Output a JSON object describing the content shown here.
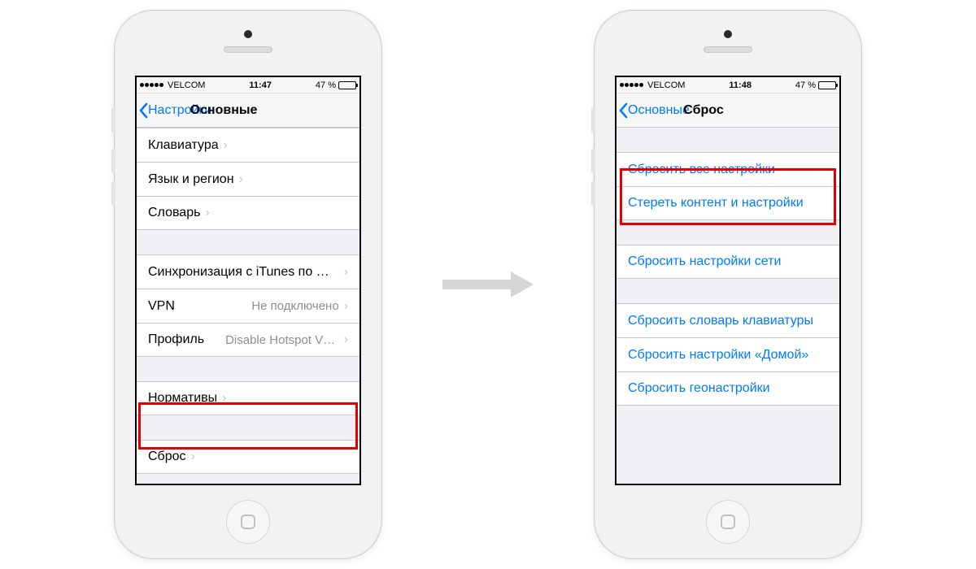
{
  "carrier": "VELCOM",
  "battery_pct": "47 %",
  "left": {
    "time": "11:47",
    "back_label": "Настройки",
    "title": "Основные",
    "rows": {
      "keyboard": "Клавиатура",
      "language": "Язык и регион",
      "dictionary": "Словарь",
      "itunes": "Синхронизация с iTunes по Wi-Fi",
      "vpn": "VPN",
      "vpn_value": "Не подключено",
      "profile": "Профиль",
      "profile_value": "Disable Hotspot VPN",
      "regulatory": "Нормативы",
      "reset": "Сброс"
    }
  },
  "right": {
    "time": "11:48",
    "back_label": "Основные",
    "title": "Сброс",
    "rows": {
      "reset_all": "Сбросить все настройки",
      "erase": "Стереть контент и настройки",
      "reset_network": "Сбросить настройки сети",
      "reset_keyboard": "Сбросить словарь клавиатуры",
      "reset_home": "Сбросить настройки «Домой»",
      "reset_location": "Сбросить геонастройки"
    }
  }
}
